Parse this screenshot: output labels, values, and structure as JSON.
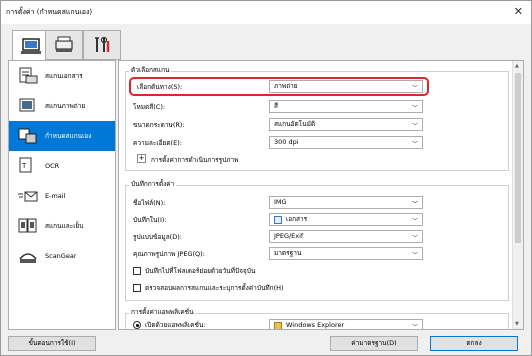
{
  "window": {
    "title": "การตั้งค่า (กำหนดสแกนเอง)",
    "close": "✕"
  },
  "tabs": [
    {
      "icon": "scan-from-computer-icon"
    },
    {
      "icon": "scan-from-panel-icon"
    },
    {
      "icon": "general-settings-tools-icon"
    }
  ],
  "nav": [
    {
      "label": "สแกนเอกสาร",
      "icon": "document-scan-icon"
    },
    {
      "label": "สแกนภาพถ่าย",
      "icon": "photo-scan-icon"
    },
    {
      "label": "กำหนดสแกนเอง",
      "icon": "custom-scan-icon"
    },
    {
      "label": "OCR",
      "icon": "ocr-icon"
    },
    {
      "label": "E-mail",
      "icon": "email-icon"
    },
    {
      "label": "สแกนและเย็บ",
      "icon": "stitch-icon"
    },
    {
      "label": "ScanGear",
      "icon": "scangear-icon"
    }
  ],
  "scan_options": {
    "title": "ตัวเลือกสแกน",
    "fields": [
      {
        "label": "เลือกต้นทาง(S):",
        "value": "ภาพถ่าย"
      },
      {
        "label": "โหมดสี(C):",
        "value": "สี"
      },
      {
        "label": "ขนาดกระดาษ(R):",
        "value": "สแกนอัตโนมัติ"
      },
      {
        "label": "ความละเอียด(E):",
        "value": "300 dpi"
      }
    ],
    "image_processing": "การตั้งค่าการดำเนินการรูปภาพ",
    "expand": "+"
  },
  "save_settings": {
    "title": "บันทึกการตั้งค่า",
    "file_name_label": "ชื่อไฟล์(N):",
    "file_name_value": "IMG",
    "save_in_label": "บันทึกใน(I):",
    "save_in_value": "เอกสาร",
    "format_label": "รูปแบบข้อมูล(D):",
    "format_value": "JPEG/Exif",
    "quality_label": "คุณภาพรูปภาพ JPEG(Q):",
    "quality_value": "มาตรฐาน",
    "subfolder_label": "บันทึกไปที่โฟลเดอร์ย่อยด้วยวันที่ปัจจุบัน",
    "check_results_label": "ตรวจสอบผลการสแกนและระบุการตั้งค่าบันทึก(H)"
  },
  "app_settings": {
    "title": "การตั้งค่าแอพพลิเคชั่น",
    "open_with_label": "เปิดด้วยแอพพลิเคชั่น:",
    "open_with_value": "Windows Explorer"
  },
  "buttons": {
    "instructions": "ขั้นตอนการใช้(I)",
    "defaults": "ค่ามาตรฐาน(D)",
    "ok": "ตกลง"
  },
  "colors": {
    "accent": "#0078d7",
    "highlight": "#d9272e"
  }
}
